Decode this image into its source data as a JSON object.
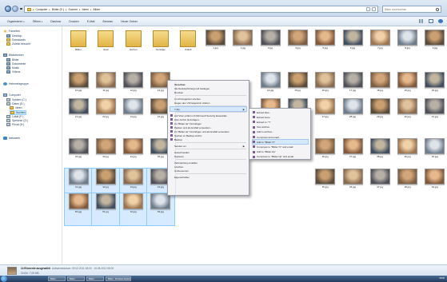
{
  "address": {
    "crumbs": [
      "Computer",
      "Bilder (E:)",
      "Suchen",
      "Ideen",
      "Bilder"
    ],
    "search_placeholder": "Bilder durchsuchen"
  },
  "toolbar": {
    "organize": "Organisieren",
    "open": "Öffnen",
    "slideshow": "Diashow",
    "print": "Drucken",
    "email": "E-Mail",
    "burn": "Brennen",
    "new_folder": "Neuer Ordner"
  },
  "nav": {
    "favorites": "Favoriten",
    "desktop": "Desktop",
    "downloads": "Downloads",
    "recent": "Zuletzt besucht",
    "libraries": "Bibliotheken",
    "pictures": "Bilder",
    "documents": "Dokumente",
    "music": "Musik",
    "videos": "Videos",
    "homegroup": "Heimnetzgruppe",
    "computer": "Computer",
    "drive_c": "System (C:)",
    "drive_e": "Daten (E:)",
    "ideen": "Ideen",
    "suchen": "Suchen",
    "drive_f": "Lokal (F:)",
    "drive_g": "Speicher (G:)",
    "drive_h": "Privat (H:)",
    "network": "Netzwerk"
  },
  "files": [
    {
      "label": "Bilder",
      "kind": "folder"
    },
    {
      "label": "Ideen",
      "kind": "folder"
    },
    {
      "label": "Suchen",
      "kind": "folder"
    },
    {
      "label": "Sonstige",
      "kind": "folder"
    },
    {
      "label": "Urlaub",
      "kind": "folder"
    },
    {
      "label": "1.jpg",
      "kind": "photo"
    },
    {
      "label": "2.jpg",
      "kind": "photo"
    },
    {
      "label": "3.jpg",
      "kind": "photo"
    },
    {
      "label": "4.jpg",
      "kind": "photo"
    },
    {
      "label": "5.jpg",
      "kind": "photo"
    },
    {
      "label": "6.jpg",
      "kind": "photo"
    },
    {
      "label": "7.jpg",
      "kind": "photo"
    },
    {
      "label": "8.jpg",
      "kind": "photo"
    },
    {
      "label": "9.jpg",
      "kind": "photo"
    },
    {
      "label": "10.jpg",
      "kind": "photo"
    },
    {
      "label": "11.jpg",
      "kind": "photo"
    },
    {
      "label": "12.jpg",
      "kind": "photo"
    },
    {
      "label": "13.jpg",
      "kind": "photo"
    },
    {
      "label": "",
      "kind": "hidden"
    },
    {
      "label": "",
      "kind": "hidden"
    },
    {
      "label": "",
      "kind": "hidden"
    },
    {
      "label": "14.jpg",
      "kind": "photo"
    },
    {
      "label": "15.jpg",
      "kind": "photo"
    },
    {
      "label": "16.jpg",
      "kind": "photo"
    },
    {
      "label": "17.jpg",
      "kind": "photo"
    },
    {
      "label": "18.jpg",
      "kind": "photo"
    },
    {
      "label": "19.jpg",
      "kind": "photo"
    },
    {
      "label": "20.jpg",
      "kind": "photo"
    },
    {
      "label": "21.jpg",
      "kind": "photo"
    },
    {
      "label": "22.jpg",
      "kind": "photo"
    },
    {
      "label": "23.jpg",
      "kind": "photo"
    },
    {
      "label": "24.jpg",
      "kind": "photo"
    },
    {
      "label": "",
      "kind": "hidden"
    },
    {
      "label": "",
      "kind": "hidden"
    },
    {
      "label": "",
      "kind": "hidden"
    },
    {
      "label": "25.jpg",
      "kind": "photo"
    },
    {
      "label": "26.jpg",
      "kind": "photo"
    },
    {
      "label": "27.jpg",
      "kind": "photo"
    },
    {
      "label": "28.jpg",
      "kind": "photo"
    },
    {
      "label": "29.jpg",
      "kind": "photo"
    },
    {
      "label": "30.jpg",
      "kind": "photo"
    },
    {
      "label": "31.jpg",
      "kind": "photo"
    },
    {
      "label": "32.jpg",
      "kind": "photo"
    },
    {
      "label": "33.jpg",
      "kind": "photo"
    },
    {
      "label": "34.jpg",
      "kind": "photo"
    },
    {
      "label": "35.jpg",
      "kind": "photo"
    },
    {
      "label": "",
      "kind": "hidden"
    },
    {
      "label": "",
      "kind": "hidden"
    },
    {
      "label": "",
      "kind": "hidden"
    },
    {
      "label": "",
      "kind": "hidden"
    },
    {
      "label": "",
      "kind": "hidden"
    },
    {
      "label": "36.jpg",
      "kind": "photo"
    },
    {
      "label": "37.jpg",
      "kind": "photo"
    },
    {
      "label": "38.jpg",
      "kind": "photo"
    },
    {
      "label": "39.jpg",
      "kind": "photo"
    },
    {
      "label": "40.jpg",
      "kind": "photo"
    },
    {
      "label": "41.jpg",
      "kind": "photo",
      "sel": true
    },
    {
      "label": "42.jpg",
      "kind": "photo",
      "sel": true
    },
    {
      "label": "43.jpg",
      "kind": "photo",
      "sel": true
    },
    {
      "label": "44.jpg",
      "kind": "photo",
      "sel": true
    },
    {
      "label": "",
      "kind": "hidden"
    },
    {
      "label": "",
      "kind": "hidden"
    },
    {
      "label": "",
      "kind": "hidden"
    },
    {
      "label": "",
      "kind": "hidden"
    },
    {
      "label": "",
      "kind": "hidden"
    },
    {
      "label": "45.jpg",
      "kind": "photo"
    },
    {
      "label": "46.jpg",
      "kind": "photo"
    },
    {
      "label": "47.jpg",
      "kind": "photo"
    },
    {
      "label": "48.jpg",
      "kind": "photo"
    },
    {
      "label": "49.jpg",
      "kind": "photo"
    },
    {
      "label": "50.jpg",
      "kind": "photo",
      "sel": true
    },
    {
      "label": "51.jpg",
      "kind": "photo",
      "sel": true
    },
    {
      "label": "52.jpg",
      "kind": "photo",
      "sel": true
    },
    {
      "label": "53.jpg",
      "kind": "photo",
      "sel": true
    }
  ],
  "context_menu": {
    "items": [
      {
        "label": "Vorschau",
        "bold": true
      },
      {
        "label": "Als Desktophintergrund festlegen"
      },
      {
        "label": "Drucken"
      },
      {
        "sep": true
      },
      {
        "label": "Im Uhrzeigersinn drehen"
      },
      {
        "label": "Gegen den Uhrzeigersinn drehen"
      },
      {
        "sep": true
      },
      {
        "label": "7-Zip",
        "sub": true,
        "hl": true
      },
      {
        "sep": true
      },
      {
        "label": "Auf Viren prüfen mit Microsoft Security Essentials",
        "icon": true
      },
      {
        "label": "Zum Archiv hinzufügen...",
        "icon": true
      },
      {
        "label": "Zu \"Bilder.rar\" hinzufügen",
        "icon": true
      },
      {
        "label": "Packen und als E-Mail versenden...",
        "icon": true
      },
      {
        "label": "Zu \"Bilder.rar\" hinzufügen und als E-Mail versenden",
        "icon": true
      },
      {
        "label": "Suchen im Backup-Archiv",
        "icon": true
      },
      {
        "label": "Backup",
        "icon": true
      },
      {
        "sep": true
      },
      {
        "label": "Senden an",
        "sub": true
      },
      {
        "sep": true
      },
      {
        "label": "Ausschneiden"
      },
      {
        "label": "Kopieren"
      },
      {
        "sep": true
      },
      {
        "label": "Verknüpfung erstellen"
      },
      {
        "label": "Löschen"
      },
      {
        "label": "Umbenennen"
      },
      {
        "sep": true
      },
      {
        "label": "Eigenschaften"
      }
    ]
  },
  "submenu": {
    "items": [
      {
        "label": "Extract files..."
      },
      {
        "label": "Extract Here"
      },
      {
        "label": "Extract to \"*\\\""
      },
      {
        "label": "Test archive"
      },
      {
        "label": "Add to archive..."
      },
      {
        "label": "Compress and email..."
      },
      {
        "label": "Add to \"Bilder.7z\"",
        "hl": true
      },
      {
        "label": "Compress to \"Bilder.7z\" and email"
      },
      {
        "label": "Add to \"Bilder.zip\""
      },
      {
        "label": "Compress to \"Bilder.zip\" and email"
      }
    ]
  },
  "details": {
    "count": "14 Elemente ausgewählt",
    "meta": "Aufnahmedatum: 09.02.2011 08:00 - 16.08.2012 08:00",
    "extra": "Größe: 7,05 MB"
  },
  "taskbar": {
    "tasks": [
      "Bilder",
      "Bilder",
      "Bilder",
      "Bilder - Windows Explorer"
    ],
    "clock": "08:00"
  }
}
